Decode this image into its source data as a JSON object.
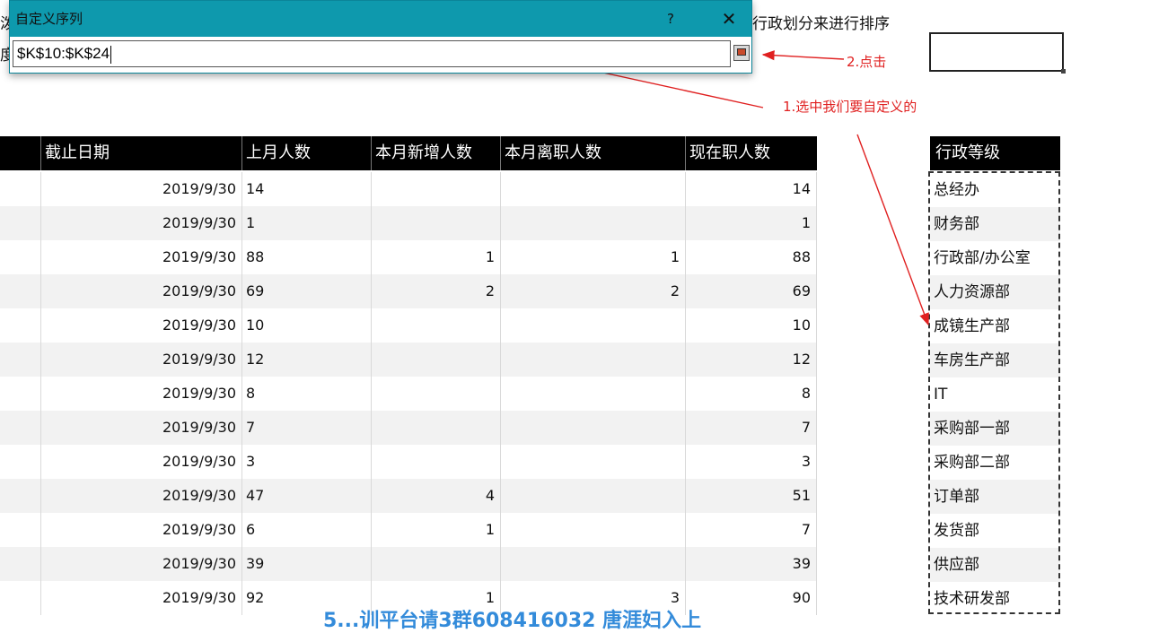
{
  "background": {
    "left_chars": [
      "泼",
      "度"
    ],
    "instruction_text": "行政划分来进行排序"
  },
  "dialog": {
    "title": "自定义序列",
    "help": "?",
    "close": "✕",
    "input_value": "$K$10:$K$24"
  },
  "annotations": {
    "step1": "1.选中我们要自定义的",
    "step2": "2.点击",
    "color": "#e02020"
  },
  "table": {
    "headers": [
      "截止日期",
      "上月人数",
      "本月新增人数",
      "本月离职人数",
      "现在职人数"
    ],
    "rows": [
      [
        "2019/9/30",
        "14",
        "",
        "",
        "14"
      ],
      [
        "2019/9/30",
        "1",
        "",
        "",
        "1"
      ],
      [
        "2019/9/30",
        "88",
        "1",
        "1",
        "88"
      ],
      [
        "2019/9/30",
        "69",
        "2",
        "2",
        "69"
      ],
      [
        "2019/9/30",
        "10",
        "",
        "",
        "10"
      ],
      [
        "2019/9/30",
        "12",
        "",
        "",
        "12"
      ],
      [
        "2019/9/30",
        "8",
        "",
        "",
        "8"
      ],
      [
        "2019/9/30",
        "7",
        "",
        "",
        "7"
      ],
      [
        "2019/9/30",
        "3",
        "",
        "",
        "3"
      ],
      [
        "2019/9/30",
        "47",
        "4",
        "",
        "51"
      ],
      [
        "2019/9/30",
        "6",
        "1",
        "",
        "7"
      ],
      [
        "2019/9/30",
        "39",
        "",
        "",
        "39"
      ],
      [
        "2019/9/30",
        "92",
        "1",
        "3",
        "90"
      ]
    ]
  },
  "rank_list": {
    "header": "行政等级",
    "items": [
      "总经办",
      "财务部",
      "行政部/办公室",
      "人力资源部",
      "成镜生产部",
      "车房生产部",
      "IT",
      "采购部一部",
      "采购部二部",
      "订单部",
      "发货部",
      "供应部",
      "技术研发部"
    ]
  },
  "watermark": "5...训平台请3群608416032 唐涯妇入上"
}
